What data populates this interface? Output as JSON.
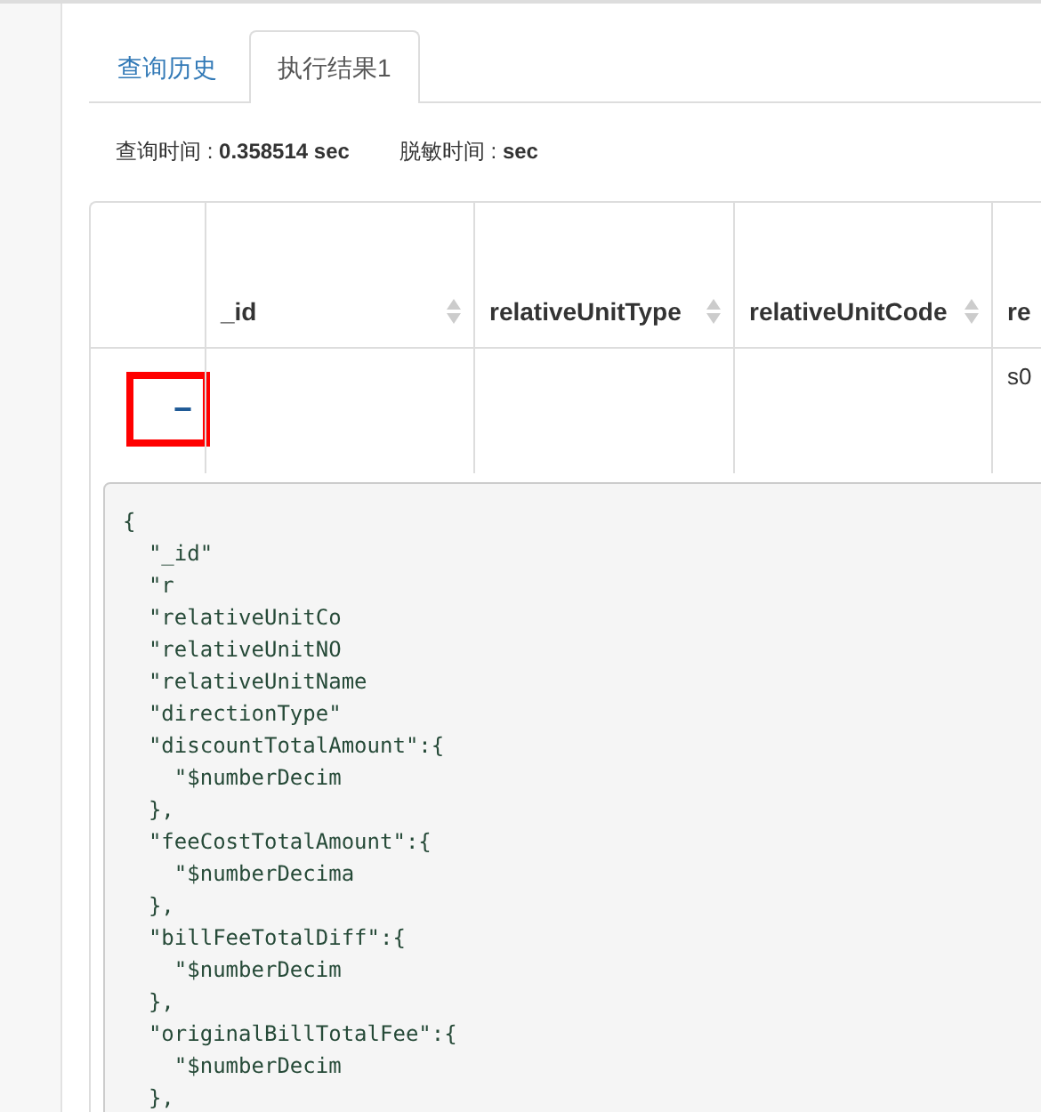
{
  "tabs": [
    {
      "label": "查询历史",
      "selected": false
    },
    {
      "label": "执行结果1",
      "selected": true
    }
  ],
  "stats": [
    {
      "label": "查询时间 : ",
      "value": "0.358514 sec"
    },
    {
      "label": "脱敏时间 : ",
      "value": "sec"
    }
  ],
  "table": {
    "columns": [
      {
        "label": "_id",
        "sortable": true
      },
      {
        "label": "relativeUnitType",
        "sortable": true
      },
      {
        "label": "relativeUnitCode",
        "sortable": true
      },
      {
        "label": "re",
        "sortable": false
      }
    ],
    "rows": [
      {
        "expanded": true,
        "cells": [
          "",
          "",
          "",
          "s0"
        ]
      }
    ]
  },
  "json_view": {
    "lines": [
      "{",
      "  \"_id\"",
      "  \"r",
      "  \"relativeUnitCo",
      "  \"relativeUnitNO",
      "  \"relativeUnitName",
      "  \"directionType\"",
      "  \"discountTotalAmount\":{",
      "    \"$numberDecim",
      "  },",
      "  \"feeCostTotalAmount\":{",
      "    \"$numberDecima",
      "  },",
      "  \"billFeeTotalDiff\":{",
      "    \"$numberDecim",
      "  },",
      "  \"originalBillTotalFee\":{",
      "    \"$numberDecim",
      "  },"
    ]
  },
  "expand_button": {
    "label": "−"
  }
}
